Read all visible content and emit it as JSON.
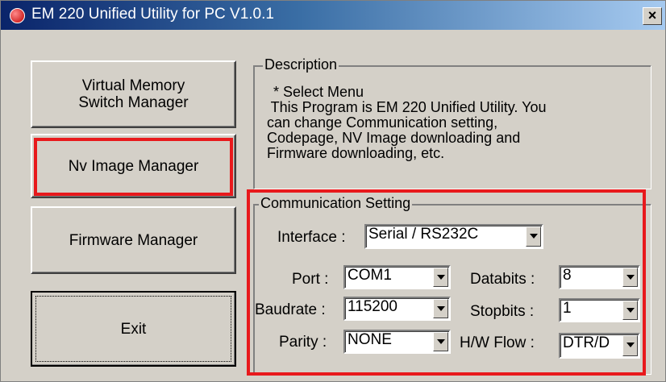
{
  "window": {
    "title": "EM 220 Unified Utility for PC V1.0.1",
    "close_label": "×"
  },
  "left_menu": {
    "virtual_memory_line1": "Virtual Memory",
    "virtual_memory_line2": "Switch Manager",
    "nv_image": "Nv Image Manager",
    "firmware": "Firmware Manager",
    "exit": "Exit"
  },
  "description": {
    "title": "Description",
    "lines": [
      "* Select Menu",
      " This Program is EM 220 Unified Utility. You",
      "can change Communication setting,",
      "Codepage, NV Image downloading and",
      "Firmware downloading, etc."
    ]
  },
  "communication": {
    "title": "Communication Setting",
    "interface_label": "Interface :",
    "interface_value": "Serial / RS232C",
    "port_label": "Port :",
    "port_value": "COM1",
    "baudrate_label": "Baudrate :",
    "baudrate_value": "115200",
    "parity_label": "Parity :",
    "parity_value": "NONE",
    "databits_label": "Databits :",
    "databits_value": "8",
    "stopbits_label": "Stopbits :",
    "stopbits_value": "1",
    "hwflow_label": "H/W Flow :",
    "hwflow_value": "DTR/D"
  },
  "colors": {
    "highlight": "#e8191c",
    "dialog_bg": "#d4d0c8",
    "titlebar_start": "#0a246a",
    "titlebar_end": "#a6caf0"
  },
  "icons": {
    "app": "app-logo-icon",
    "close": "close-icon",
    "dropdown": "chevron-down-icon"
  }
}
